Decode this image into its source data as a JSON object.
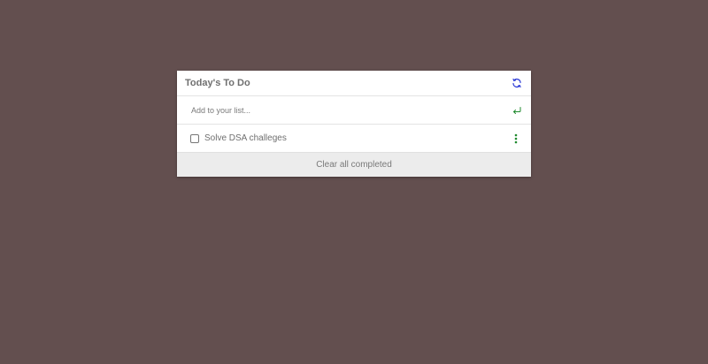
{
  "card": {
    "title": "Today's To Do",
    "refresh_icon": "refresh-icon",
    "accent_color": "#2d3bd6",
    "action_color": "#1f8a2e"
  },
  "add": {
    "placeholder": "Add to your list...",
    "value": "",
    "enter_icon": "enter-return-icon"
  },
  "items": [
    {
      "label": "Solve DSA challeges",
      "checked": false,
      "menu_icon": "more-vertical-icon"
    }
  ],
  "footer": {
    "clear_label": "Clear all completed"
  }
}
